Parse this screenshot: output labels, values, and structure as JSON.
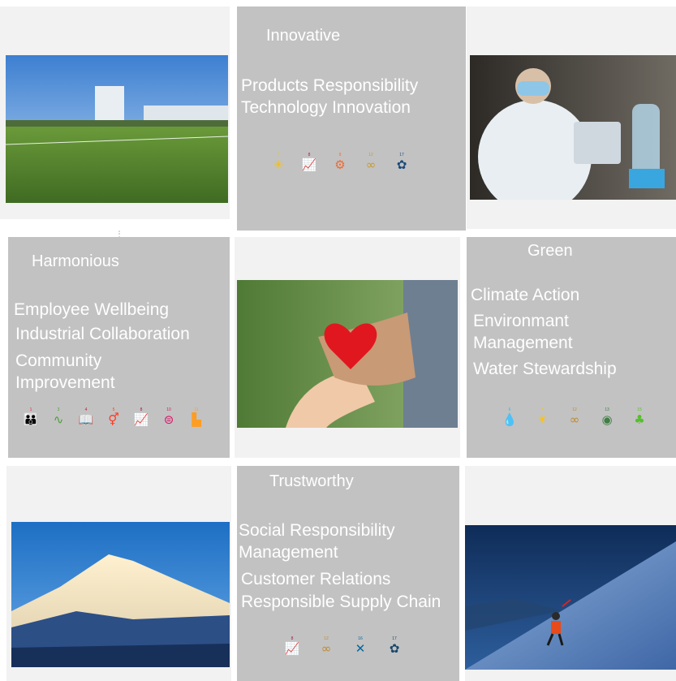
{
  "pillars": {
    "innovative": {
      "title": "Innovative",
      "items": [
        "Products Responsibility",
        "Technology Innovation"
      ],
      "sdg_icons": [
        {
          "number": "7",
          "icon": "sun-icon",
          "color": "#f0c01e"
        },
        {
          "number": "8",
          "icon": "growth-chart-icon",
          "color": "#a8213a"
        },
        {
          "number": "9",
          "icon": "industry-icon",
          "color": "#f26a2d"
        },
        {
          "number": "12",
          "icon": "infinity-icon",
          "color": "#c99a2e"
        },
        {
          "number": "17",
          "icon": "partnership-icon",
          "color": "#1b4a7a"
        }
      ]
    },
    "harmonious": {
      "title": "Harmonious",
      "items": [
        "Employee Wellbeing",
        "Industrial Collaboration",
        "Community\nImprovement"
      ],
      "sdg_icons": [
        {
          "number": "1",
          "icon": "people-icon",
          "color": "#e5243b"
        },
        {
          "number": "3",
          "icon": "heartbeat-icon",
          "color": "#4c9f38"
        },
        {
          "number": "4",
          "icon": "book-icon",
          "color": "#c5192d"
        },
        {
          "number": "5",
          "icon": "gender-icon",
          "color": "#ff3a21"
        },
        {
          "number": "8",
          "icon": "growth-chart-icon",
          "color": "#a21942"
        },
        {
          "number": "10",
          "icon": "equality-icon",
          "color": "#dd1367"
        },
        {
          "number": "11",
          "icon": "city-icon",
          "color": "#fd9d24"
        }
      ]
    },
    "green": {
      "title": "Green",
      "items": [
        "Climate Action",
        "Environmant\nManagement",
        "Water Stewardship"
      ],
      "sdg_icons": [
        {
          "number": "6",
          "icon": "water-drop-icon",
          "color": "#26bde2"
        },
        {
          "number": "7",
          "icon": "sun-icon",
          "color": "#fcc30b"
        },
        {
          "number": "12",
          "icon": "infinity-icon",
          "color": "#bf8b2e"
        },
        {
          "number": "13",
          "icon": "eye-globe-icon",
          "color": "#3f7e44"
        },
        {
          "number": "15",
          "icon": "tree-icon",
          "color": "#56c02b"
        }
      ]
    },
    "trustworthy": {
      "title": "Trustworthy",
      "items": [
        "Social Responsibility\nManagement",
        "Customer Relations",
        "Responsible Supply Chain"
      ],
      "sdg_icons": [
        {
          "number": "8",
          "icon": "growth-chart-icon",
          "color": "#a21942"
        },
        {
          "number": "12",
          "icon": "infinity-icon",
          "color": "#bf8b2e"
        },
        {
          "number": "16",
          "icon": "dove-icon",
          "color": "#00689d"
        },
        {
          "number": "17",
          "icon": "partnership-icon",
          "color": "#19486a"
        }
      ]
    }
  }
}
